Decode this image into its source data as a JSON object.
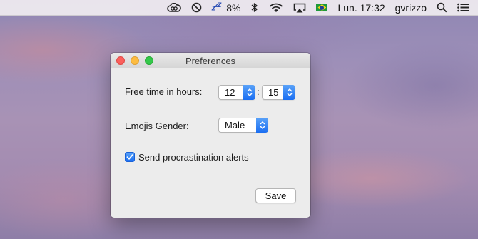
{
  "menubar": {
    "battery_percent": "8%",
    "clock": "Lun. 17:32",
    "username": "gvrizzo",
    "icons": [
      "creative-cloud-icon",
      "block-icon",
      "sleep-zzz-icon",
      "bluetooth-icon",
      "wifi-icon",
      "airplay-icon",
      "brazil-flag-icon",
      "search-icon",
      "menu-list-icon"
    ],
    "colors": {
      "flag_green": "#1e9a3b",
      "flag_yellow": "#f5d21a",
      "flag_blue": "#233f95"
    }
  },
  "window": {
    "title": "Preferences",
    "traffic_lights": {
      "close": "#fc605c",
      "minimize": "#fdbc40",
      "maximize": "#34c84a"
    },
    "free_time": {
      "label": "Free time in hours:",
      "hours": "12",
      "separator": ":",
      "minutes": "15"
    },
    "emojis_gender": {
      "label": "Emojis Gender:",
      "selected": "Male"
    },
    "procrastination": {
      "label": "Send procrastination alerts",
      "checked": true
    },
    "save_label": "Save",
    "accent_color": "#1a6ef2"
  }
}
